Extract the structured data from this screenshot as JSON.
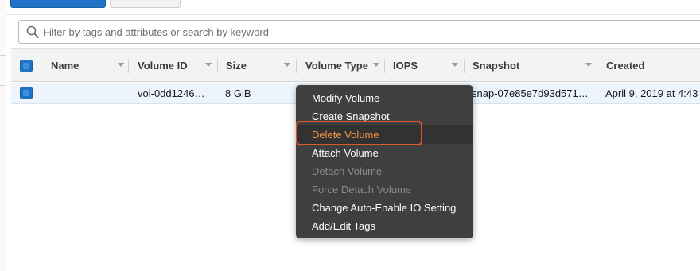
{
  "search": {
    "placeholder": "Filter by tags and attributes or search by keyword"
  },
  "table": {
    "columns": [
      "Name",
      "Volume ID",
      "Size",
      "Volume Type",
      "IOPS",
      "Snapshot",
      "Created"
    ],
    "rows": [
      {
        "name": "",
        "volume_id": "vol-0dd1246…",
        "size": "8 GiB",
        "volume_type": "",
        "iops": "",
        "snapshot": "snap-07e85e7d93d571…",
        "created": "April 9, 2019 at 4:43"
      }
    ]
  },
  "context_menu": {
    "items": [
      {
        "label": "Modify Volume",
        "state": "enabled"
      },
      {
        "label": "Create Snapshot",
        "state": "enabled"
      },
      {
        "label": "Delete Volume",
        "state": "highlighted"
      },
      {
        "label": "Attach Volume",
        "state": "enabled"
      },
      {
        "label": "Detach Volume",
        "state": "disabled"
      },
      {
        "label": "Force Detach Volume",
        "state": "disabled"
      },
      {
        "label": "Change Auto-Enable IO Setting",
        "state": "enabled"
      },
      {
        "label": "Add/Edit Tags",
        "state": "enabled"
      }
    ]
  },
  "colors": {
    "accent": "#1f72c4",
    "highlight": "#f29441",
    "callout": "#e2562b",
    "menu_bg": "#3f3f3f"
  },
  "icons": {
    "search": "search-icon",
    "sort": "sort-caret-icon"
  }
}
